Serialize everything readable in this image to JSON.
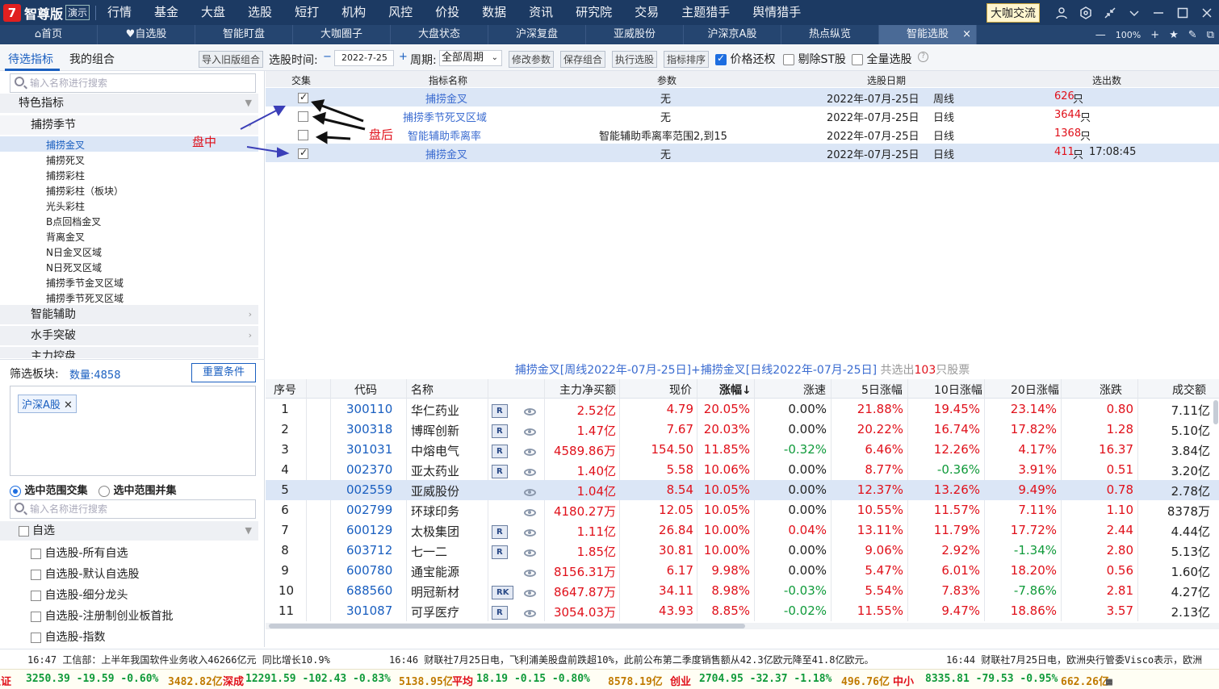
{
  "app": {
    "logo_badge": "7",
    "name": "智尊版",
    "demo": "演示"
  },
  "menu": [
    "行情",
    "基金",
    "大盘",
    "选股",
    "短打",
    "机构",
    "风控",
    "价投",
    "数据",
    "资讯",
    "研究院",
    "交易",
    "主题猎手",
    "舆情猎手"
  ],
  "top_right": {
    "dk_label": "大咖交流"
  },
  "tabs": [
    {
      "label": "首页",
      "icon": "home-icon"
    },
    {
      "label": "自选股",
      "icon": "heart-icon"
    },
    {
      "label": "智能盯盘"
    },
    {
      "label": "大咖圈子"
    },
    {
      "label": "大盘状态"
    },
    {
      "label": "沪深复盘"
    },
    {
      "label": "亚威股份"
    },
    {
      "label": "沪深京A股"
    },
    {
      "label": "热点纵览"
    },
    {
      "label": "智能选股",
      "active": true
    }
  ],
  "tab_tools": {
    "zoom": "100%"
  },
  "left_tabs": {
    "candidate": "待选指标",
    "combo": "我的组合",
    "import_btn": "导入旧版组合"
  },
  "toolbar": {
    "date_label": "选股时间:",
    "date_value": "2022-7-25",
    "period_label": "周期:",
    "period_value": "全部周期",
    "modify": "修改参数",
    "save": "保存组合",
    "execute": "执行选股",
    "sort": "指标排序",
    "price_restore": "价格还权",
    "exclude_st": "剔除ST股",
    "all_stock": "全量选股"
  },
  "sidebar": {
    "search_placeholder": "输入名称进行搜索",
    "group_special": "特色指标",
    "sub_season": "捕捞季节",
    "leaves": [
      "捕捞金叉",
      "捕捞死叉",
      "捕捞彩柱",
      "捕捞彩柱（板块）",
      "光头彩柱",
      "B点回档金叉",
      "背离金叉",
      "N日金叉区域",
      "N日死叉区域",
      "捕捞季节金叉区域",
      "捕捞季节死叉区域"
    ],
    "group_assist": "智能辅助",
    "group_water": "水手突破",
    "group_main": "主力控盘",
    "filter_label": "筛选板块:",
    "count_label": "数量:4858",
    "reset_btn": "重置条件",
    "selected_tag": "沪深A股",
    "radio_inter": "选中范围交集",
    "radio_union": "选中范围并集",
    "search2_placeholder": "输入名称进行搜索",
    "group_fav": "自选",
    "fav_items": [
      "自选股-所有自选",
      "自选股-默认自选股",
      "自选股-细分龙头",
      "自选股-注册制创业板首批",
      "自选股-指数"
    ]
  },
  "annotations": {
    "mid": "盘中",
    "after": "盘后"
  },
  "criteria": {
    "headers": {
      "intersect": "交集",
      "name": "指标名称",
      "param": "参数",
      "date": "选股日期",
      "count": "选出数"
    },
    "rows": [
      {
        "checked": true,
        "name": "捕捞金叉",
        "param": "无",
        "date": "2022年-07月-25日",
        "period": "周线",
        "count": "626",
        "unit": "只",
        "time": ""
      },
      {
        "checked": false,
        "name": "捕捞季节死叉区域",
        "param": "无",
        "date": "2022年-07月-25日",
        "period": "日线",
        "count": "3644",
        "unit": "只",
        "time": ""
      },
      {
        "checked": false,
        "name": "智能辅助乖离率",
        "param": "智能辅助乖离率范围2,到15",
        "date": "2022年-07月-25日",
        "period": "日线",
        "count": "1368",
        "unit": "只",
        "time": ""
      },
      {
        "checked": true,
        "name": "捕捞金叉",
        "param": "无",
        "date": "2022年-07月-25日",
        "period": "日线",
        "count": "411",
        "unit": "只",
        "time": "17:08:45"
      }
    ]
  },
  "summary": {
    "text": "捕捞金叉[周线2022年-07月-25日]+捕捞金叉[日线2022年-07月-25日]",
    "pre": "共选出",
    "count": "103",
    "post": "只股票"
  },
  "results": {
    "headers": [
      "序号",
      "代码",
      "名称",
      "主力净买额",
      "现价",
      "涨幅↓",
      "涨速",
      "5日涨幅",
      "10日涨幅",
      "20日涨幅",
      "涨跌",
      "成交额"
    ],
    "rows": [
      {
        "n": "1",
        "code": "300110",
        "name": "华仁药业",
        "badge": "R",
        "net": "2.52亿",
        "price": "4.79",
        "chg": "20.05%",
        "speed": "0.00%",
        "d5": "21.88%",
        "d10": "19.45%",
        "d20": "23.14%",
        "diff": "0.80",
        "amt": "7.11亿"
      },
      {
        "n": "2",
        "code": "300318",
        "name": "博晖创新",
        "badge": "R",
        "net": "1.47亿",
        "price": "7.67",
        "chg": "20.03%",
        "speed": "0.00%",
        "d5": "20.22%",
        "d10": "16.74%",
        "d20": "17.82%",
        "diff": "1.28",
        "amt": "5.10亿"
      },
      {
        "n": "3",
        "code": "301031",
        "name": "中熔电气",
        "badge": "R",
        "net": "4589.86万",
        "price": "154.50",
        "chg": "11.85%",
        "speed": "-0.32%",
        "d5": "6.46%",
        "d10": "12.26%",
        "d20": "4.17%",
        "diff": "16.37",
        "amt": "3.84亿"
      },
      {
        "n": "4",
        "code": "002370",
        "name": "亚太药业",
        "badge": "R",
        "net": "1.40亿",
        "price": "5.58",
        "chg": "10.06%",
        "speed": "0.00%",
        "d5": "8.77%",
        "d10": "-0.36%",
        "d20": "3.91%",
        "diff": "0.51",
        "amt": "3.20亿"
      },
      {
        "n": "5",
        "code": "002559",
        "name": "亚威股份",
        "badge": "",
        "net": "1.04亿",
        "price": "8.54",
        "chg": "10.05%",
        "speed": "0.00%",
        "d5": "12.37%",
        "d10": "13.26%",
        "d20": "9.49%",
        "diff": "0.78",
        "amt": "2.78亿"
      },
      {
        "n": "6",
        "code": "002799",
        "name": "环球印务",
        "badge": "",
        "net": "4180.27万",
        "price": "12.05",
        "chg": "10.05%",
        "speed": "0.00%",
        "d5": "10.55%",
        "d10": "11.57%",
        "d20": "7.11%",
        "diff": "1.10",
        "amt": "8378万"
      },
      {
        "n": "7",
        "code": "600129",
        "name": "太极集团",
        "badge": "R",
        "net": "1.11亿",
        "price": "26.84",
        "chg": "10.00%",
        "speed": "0.04%",
        "d5": "13.11%",
        "d10": "11.79%",
        "d20": "17.72%",
        "diff": "2.44",
        "amt": "4.44亿"
      },
      {
        "n": "8",
        "code": "603712",
        "name": "七一二",
        "badge": "R",
        "net": "1.85亿",
        "price": "30.81",
        "chg": "10.00%",
        "speed": "0.00%",
        "d5": "9.06%",
        "d10": "2.92%",
        "d20": "-1.34%",
        "diff": "2.80",
        "amt": "5.13亿"
      },
      {
        "n": "9",
        "code": "600780",
        "name": "通宝能源",
        "badge": "",
        "net": "8156.31万",
        "price": "6.17",
        "chg": "9.98%",
        "speed": "0.00%",
        "d5": "5.47%",
        "d10": "6.01%",
        "d20": "18.20%",
        "diff": "0.56",
        "amt": "1.60亿"
      },
      {
        "n": "10",
        "code": "688560",
        "name": "明冠新材",
        "badge": "RK",
        "net": "8647.87万",
        "price": "34.11",
        "chg": "8.98%",
        "speed": "-0.03%",
        "d5": "5.54%",
        "d10": "7.83%",
        "d20": "-7.86%",
        "diff": "2.81",
        "amt": "4.27亿"
      },
      {
        "n": "11",
        "code": "301087",
        "name": "可孚医疗",
        "badge": "R",
        "net": "3054.03万",
        "price": "43.93",
        "chg": "8.85%",
        "speed": "-0.02%",
        "d5": "11.55%",
        "d10": "9.47%",
        "d20": "18.86%",
        "diff": "3.57",
        "amt": "2.13亿"
      }
    ]
  },
  "news": [
    "16:47 工信部：上半年我国软件业务收入46266亿元 同比增长10.9%",
    "16:46 财联社7月25日电，飞利浦美股盘前跌超10%，此前公布第二季度销售额从42.3亿欧元降至41.8亿欧元。",
    "16:44 财联社7月25日电，欧洲央行管委Visco表示，欧洲"
  ],
  "ticker": {
    "t1": "上证",
    "v1": "3250.39 -19.59 -0.60%",
    "a1": "3482.82亿",
    "t2": "深成",
    "v2": "12291.59 -102.43 -0.83%",
    "a2": "5138.95亿",
    "t3": "平均",
    "v3": "18.19 -0.15 -0.80%",
    "a3": "8578.19亿",
    "t4": "创业",
    "v4": "2704.95 -32.37 -1.18%",
    "a4": "496.76亿",
    "t5": "中小",
    "v5": "8335.81 -79.53 -0.95%",
    "a5": "662.26亿"
  },
  "colors": {
    "title_bg": "#1c3a63",
    "accent": "#1e6ee0",
    "up": "#e0101a",
    "down": "#0f9a3a"
  }
}
